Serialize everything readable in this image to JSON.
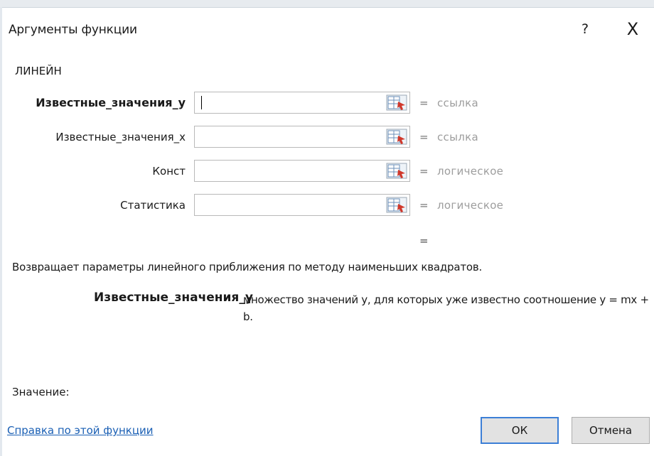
{
  "window": {
    "title": "Аргументы функции",
    "help_label": "?",
    "close_label": "X"
  },
  "function_name": "ЛИНЕЙН",
  "arguments": [
    {
      "label": "Известные_значения_у",
      "bold": true,
      "value": "",
      "eq": "=",
      "eval": "ссылка",
      "icon": "range-select-icon"
    },
    {
      "label": "Известные_значения_х",
      "bold": false,
      "value": "",
      "eq": "=",
      "eval": "ссылка",
      "icon": "range-select-icon"
    },
    {
      "label": "Конст",
      "bold": false,
      "value": "",
      "eq": "=",
      "eval": "логическое",
      "icon": "range-select-icon"
    },
    {
      "label": "Статистика",
      "bold": false,
      "value": "",
      "eq": "=",
      "eval": "логическое",
      "icon": "range-select-icon"
    }
  ],
  "result_eq": "=",
  "description": "Возвращает параметры линейного приближения по методу наименьших квадратов.",
  "arg_help": {
    "name": "Известные_значения_у",
    "text": "множество значений y, для которых уже известно соотношение y = mx + b."
  },
  "value_label": "Значение:",
  "help_link": "Справка по этой функции",
  "buttons": {
    "ok": "ОК",
    "cancel": "Отмена"
  },
  "colors": {
    "accent": "#3c7fd6",
    "link": "#1a5fb4",
    "eval_text": "#9d9d9d"
  }
}
